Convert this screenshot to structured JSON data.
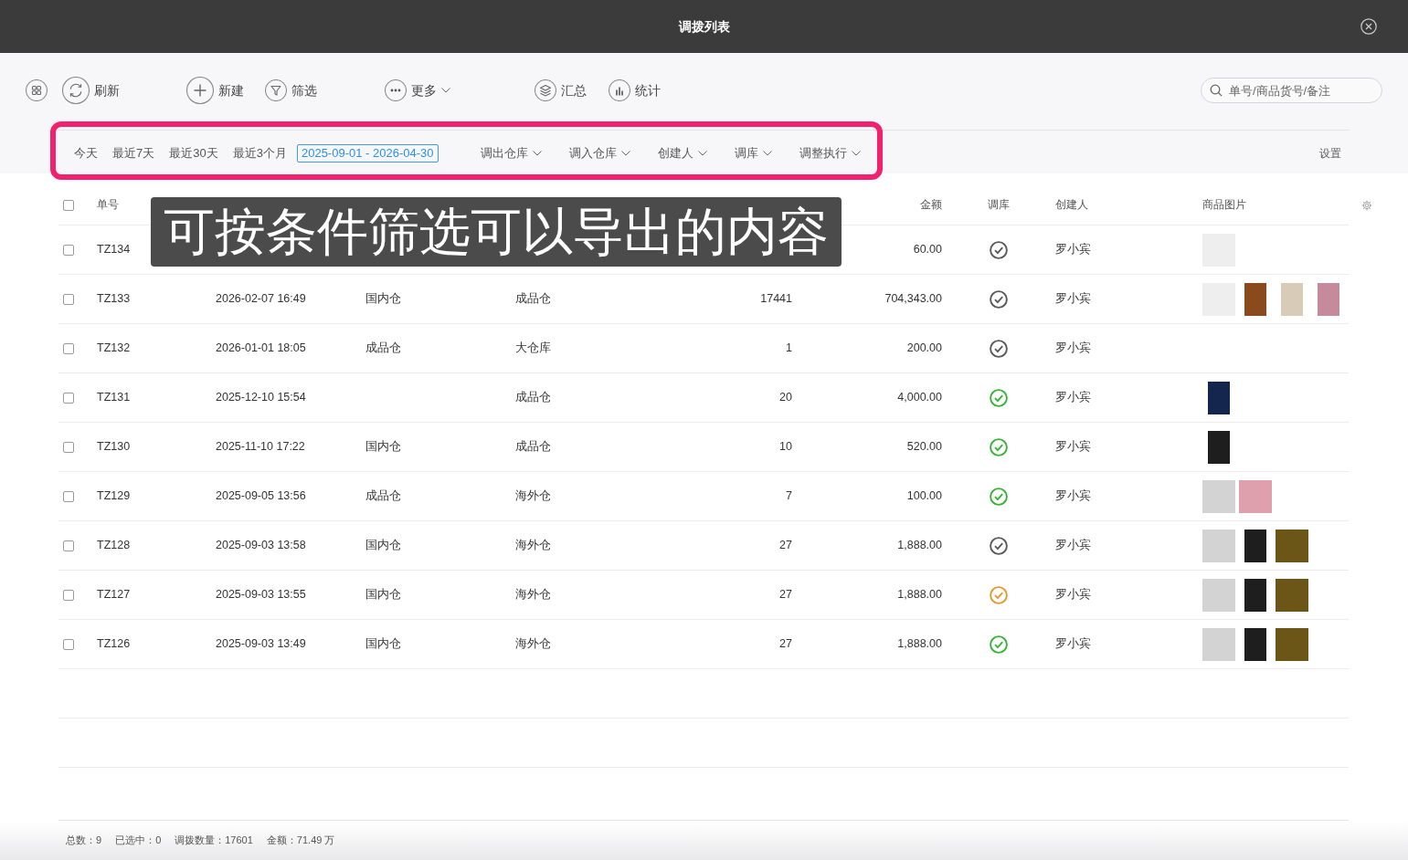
{
  "window": {
    "title": "调拨列表"
  },
  "toolbar": {
    "groups": [
      [
        {
          "kind": "apps"
        },
        {
          "kind": "refresh",
          "label": "刷新"
        }
      ],
      [
        {
          "kind": "create",
          "label": "新建"
        },
        {
          "kind": "filter",
          "label": "筛选"
        }
      ],
      [
        {
          "kind": "more",
          "label": "更多"
        }
      ],
      [
        {
          "kind": "summary",
          "label": "汇总"
        },
        {
          "kind": "stats",
          "label": "统计"
        }
      ]
    ],
    "search": {
      "placeholder": "单号/商品货号/备注"
    }
  },
  "filters": {
    "quick_ranges": [
      {
        "label": "今天",
        "selected": false
      },
      {
        "label": "最近7天",
        "selected": false
      },
      {
        "label": "最近30天",
        "selected": false
      },
      {
        "label": "最近3个月",
        "selected": false
      }
    ],
    "date_range": "2025-09-01 - 2026-04-30",
    "dropdowns": [
      "调出仓库",
      "调入仓库",
      "创建人",
      "调库",
      "调整执行"
    ],
    "settings": "设置"
  },
  "table": {
    "select_all": {
      "checked": false
    },
    "columns": [
      "单号",
      null,
      null,
      null,
      null,
      "金额",
      "调库",
      "创建人",
      "商品图片"
    ],
    "rows": [
      {
        "checked": false,
        "number": "TZ134",
        "amount": "60.00",
        "status": {
          "color": "#5a5a5a"
        },
        "creator": "罗小宾",
        "images": [
          {
            "kind": "square",
            "color": "#eeeeee"
          }
        ]
      },
      {
        "checked": false,
        "number": "TZ133",
        "time": "2026-02-07 16:49",
        "from": "国内仓",
        "to": "成品仓",
        "quantity": "17441",
        "amount": "704,343.00",
        "status": {
          "color": "#5a5a5a"
        },
        "creator": "罗小宾",
        "images": [
          {
            "kind": "square",
            "color": "#eeeeee"
          },
          {
            "kind": "portrait",
            "color": "#8b4a1c"
          },
          {
            "kind": "portrait",
            "color": "#d8ccb8"
          },
          {
            "kind": "portrait",
            "color": "#c58a9c"
          }
        ]
      },
      {
        "checked": false,
        "number": "TZ132",
        "time": "2026-01-01 18:05",
        "from": "成品仓",
        "to": "大仓库",
        "quantity": "1",
        "amount": "200.00",
        "status": {
          "color": "#5a5a5a"
        },
        "creator": "罗小宾",
        "images": []
      },
      {
        "checked": false,
        "number": "TZ131",
        "time": "2025-12-10 15:54",
        "to": "成品仓",
        "quantity": "20",
        "amount": "4,000.00",
        "status": {
          "color": "#36b336"
        },
        "creator": "罗小宾",
        "images": [
          {
            "kind": "portrait",
            "color": "#14264d"
          }
        ]
      },
      {
        "checked": false,
        "number": "TZ130",
        "time": "2025-11-10 17:22",
        "from": "国内仓",
        "to": "成品仓",
        "quantity": "10",
        "amount": "520.00",
        "status": {
          "color": "#36b336"
        },
        "creator": "罗小宾",
        "images": [
          {
            "kind": "portrait",
            "color": "#1e1e1e"
          }
        ]
      },
      {
        "checked": false,
        "number": "TZ129",
        "time": "2025-09-05 13:56",
        "from": "成品仓",
        "to": "海外仓",
        "quantity": "7",
        "amount": "100.00",
        "status": {
          "color": "#36b336"
        },
        "creator": "罗小宾",
        "images": [
          {
            "kind": "deleted"
          },
          {
            "kind": "square",
            "color": "#dea0ad"
          }
        ]
      },
      {
        "checked": false,
        "number": "TZ128",
        "time": "2025-09-03 13:58",
        "from": "国内仓",
        "to": "海外仓",
        "quantity": "27",
        "amount": "1,888.00",
        "status": {
          "color": "#5a5a5a"
        },
        "creator": "罗小宾",
        "images": [
          {
            "kind": "deleted"
          },
          {
            "kind": "portrait",
            "color": "#1e1e1e"
          },
          {
            "kind": "square",
            "color": "#6b5517"
          }
        ]
      },
      {
        "checked": false,
        "number": "TZ127",
        "time": "2025-09-03 13:55",
        "from": "国内仓",
        "to": "海外仓",
        "quantity": "27",
        "amount": "1,888.00",
        "status": {
          "color": "#e6982e"
        },
        "creator": "罗小宾",
        "images": [
          {
            "kind": "deleted"
          },
          {
            "kind": "portrait",
            "color": "#1e1e1e"
          },
          {
            "kind": "square",
            "color": "#6b5517"
          }
        ]
      },
      {
        "checked": false,
        "number": "TZ126",
        "time": "2025-09-03 13:49",
        "from": "国内仓",
        "to": "海外仓",
        "quantity": "27",
        "amount": "1,888.00",
        "status": {
          "color": "#36b336"
        },
        "creator": "罗小宾",
        "images": [
          {
            "kind": "deleted"
          },
          {
            "kind": "portrait",
            "color": "#1e1e1e"
          },
          {
            "kind": "square",
            "color": "#6b5517"
          }
        ]
      }
    ]
  },
  "footer": [
    "总数：9",
    "已选中：0",
    "调拨数量：17601",
    "金额：71.49 万"
  ],
  "annotation": {
    "caption": "可按条件筛选可以导出的内容",
    "frame": true
  }
}
